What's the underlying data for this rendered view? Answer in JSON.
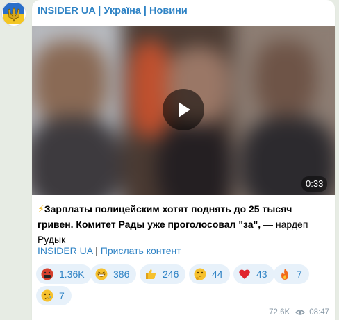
{
  "channel": {
    "name": "INSIDER UA | Україна | Новини"
  },
  "video": {
    "duration": "0:33"
  },
  "post": {
    "bolt": "⚡",
    "bold_text": "Зарплаты полицейским хотят поднять до 25 тысяч гривен. Комитет Рады уже проголосовал \"за\",",
    "rest_text": " — нардеп Рудык"
  },
  "links": {
    "channel_link": "INSIDER UA",
    "separator": "|",
    "submit_link": "Прислать контент"
  },
  "reactions": [
    {
      "emoji": "face-swearing-emoji",
      "count": "1.36K"
    },
    {
      "emoji": "grinning-face-emoji",
      "count": "386"
    },
    {
      "emoji": "thumbs-up-emoji",
      "count": "246"
    },
    {
      "emoji": "thinking-face-emoji",
      "count": "44"
    },
    {
      "emoji": "red-heart-emoji",
      "count": "43"
    },
    {
      "emoji": "fire-emoji",
      "count": "7"
    },
    {
      "emoji": "crying-face-emoji",
      "count": "7"
    }
  ],
  "meta": {
    "views": "72.6K",
    "time": "08:47"
  },
  "colors": {
    "accent": "#2f83c5",
    "reaction_bg": "#e7f1fa",
    "meta": "#8a9aa7"
  }
}
